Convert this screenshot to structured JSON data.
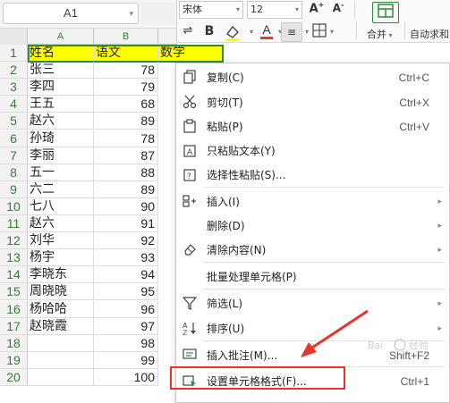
{
  "name_box": {
    "value": "A1"
  },
  "toolbar": {
    "font_name": "宋体",
    "font_size": "12",
    "bold_label": "B",
    "merge_label": "合并",
    "autosum_label": "自动求和",
    "highlight_color": "#ffff00",
    "font_color": "#e53935"
  },
  "sheet": {
    "columns": [
      "A",
      "B"
    ],
    "header_row": {
      "row": "1",
      "name": "姓名",
      "score": "语文",
      "extra": "数学"
    },
    "rows": [
      {
        "row": "2",
        "name": "张三",
        "score": "78"
      },
      {
        "row": "3",
        "name": "李四",
        "score": "79"
      },
      {
        "row": "4",
        "name": "王五",
        "score": "68"
      },
      {
        "row": "5",
        "name": "赵六",
        "score": "89"
      },
      {
        "row": "6",
        "name": "孙琦",
        "score": "78"
      },
      {
        "row": "7",
        "name": "李丽",
        "score": "87"
      },
      {
        "row": "8",
        "name": "五一",
        "score": "88"
      },
      {
        "row": "9",
        "name": "六二",
        "score": "89"
      },
      {
        "row": "10",
        "name": "七八",
        "score": "90"
      },
      {
        "row": "11",
        "name": "赵六",
        "score": "91"
      },
      {
        "row": "12",
        "name": "刘华",
        "score": "92"
      },
      {
        "row": "13",
        "name": "杨宇",
        "score": "93"
      },
      {
        "row": "14",
        "name": "李晓东",
        "score": "94"
      },
      {
        "row": "15",
        "name": "周晓晓",
        "score": "95"
      },
      {
        "row": "16",
        "name": "杨哈哈",
        "score": "96"
      },
      {
        "row": "17",
        "name": "赵晓霞",
        "score": "97"
      },
      {
        "row": "18",
        "name": "",
        "score": "98"
      },
      {
        "row": "19",
        "name": "",
        "score": "99"
      },
      {
        "row": "20",
        "name": "",
        "score": "100"
      }
    ]
  },
  "context_menu": {
    "items": [
      {
        "label": "复制(C)",
        "shortcut": "Ctrl+C",
        "icon": "copy-icon",
        "submenu": false
      },
      {
        "label": "剪切(T)",
        "shortcut": "Ctrl+X",
        "icon": "cut-icon",
        "submenu": false
      },
      {
        "label": "粘贴(P)",
        "shortcut": "Ctrl+V",
        "icon": "paste-icon",
        "submenu": false
      },
      {
        "label": "只粘贴文本(Y)",
        "shortcut": "",
        "icon": "paste-text-icon",
        "submenu": false
      },
      {
        "label": "选择性粘贴(S)...",
        "shortcut": "",
        "icon": "paste-special-icon",
        "submenu": false
      },
      {
        "label": "插入(I)",
        "shortcut": "",
        "icon": "insert-icon",
        "submenu": true
      },
      {
        "label": "删除(D)",
        "shortcut": "",
        "icon": "",
        "submenu": true
      },
      {
        "label": "清除内容(N)",
        "shortcut": "",
        "icon": "eraser-icon",
        "submenu": true
      },
      {
        "label": "批量处理单元格(P)",
        "shortcut": "",
        "icon": "",
        "submenu": false
      },
      {
        "label": "筛选(L)",
        "shortcut": "",
        "icon": "filter-icon",
        "submenu": true
      },
      {
        "label": "排序(U)",
        "shortcut": "",
        "icon": "sort-icon",
        "submenu": true
      },
      {
        "label": "插入批注(M)...",
        "shortcut": "Shift+F2",
        "icon": "comment-icon",
        "submenu": false
      },
      {
        "label": "设置单元格格式(F)...",
        "shortcut": "Ctrl+1",
        "icon": "format-cells-icon",
        "submenu": false
      }
    ]
  },
  "annotation": {
    "arrow_color": "#e8342a",
    "box_color": "#e8342a"
  }
}
